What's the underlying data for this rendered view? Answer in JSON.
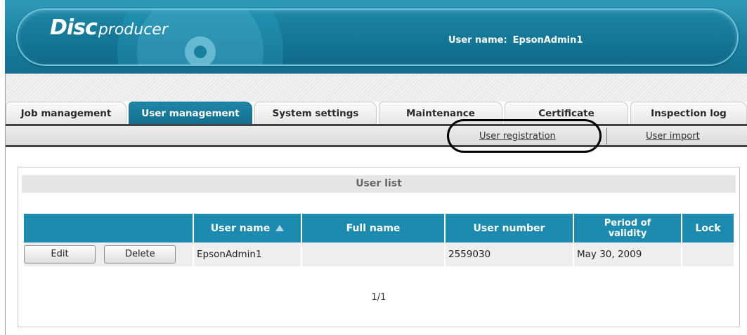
{
  "header": {
    "logo_disc": "Disc",
    "logo_producer": "producer",
    "user_label": "User name:",
    "user_value": "EpsonAdmin1"
  },
  "tabs": [
    {
      "label": "Job management"
    },
    {
      "label": "User management",
      "active": true
    },
    {
      "label": "System settings"
    },
    {
      "label": "Maintenance"
    },
    {
      "label": "Certificate"
    },
    {
      "label": "Inspection log"
    }
  ],
  "subnav": {
    "registration": "User registration",
    "import": "User import"
  },
  "user_list": {
    "title": "User list",
    "columns": {
      "user_name": "User name",
      "full_name": "Full name",
      "user_number": "User number",
      "validity_line1": "Period of",
      "validity_line2": "validity",
      "lock": "Lock"
    },
    "rows": [
      {
        "edit": "Edit",
        "delete": "Delete",
        "user_name": "EpsonAdmin1",
        "full_name": "",
        "user_number": "2559030",
        "validity": "May 30, 2009",
        "lock": ""
      }
    ],
    "pager": "1/1"
  },
  "colors": {
    "header_blue": "#1a7f9f",
    "table_header": "#1d8ab0",
    "active_tab": "#136f8d"
  },
  "icons": [
    "disc-graphic",
    "sort-ascending-icon"
  ]
}
